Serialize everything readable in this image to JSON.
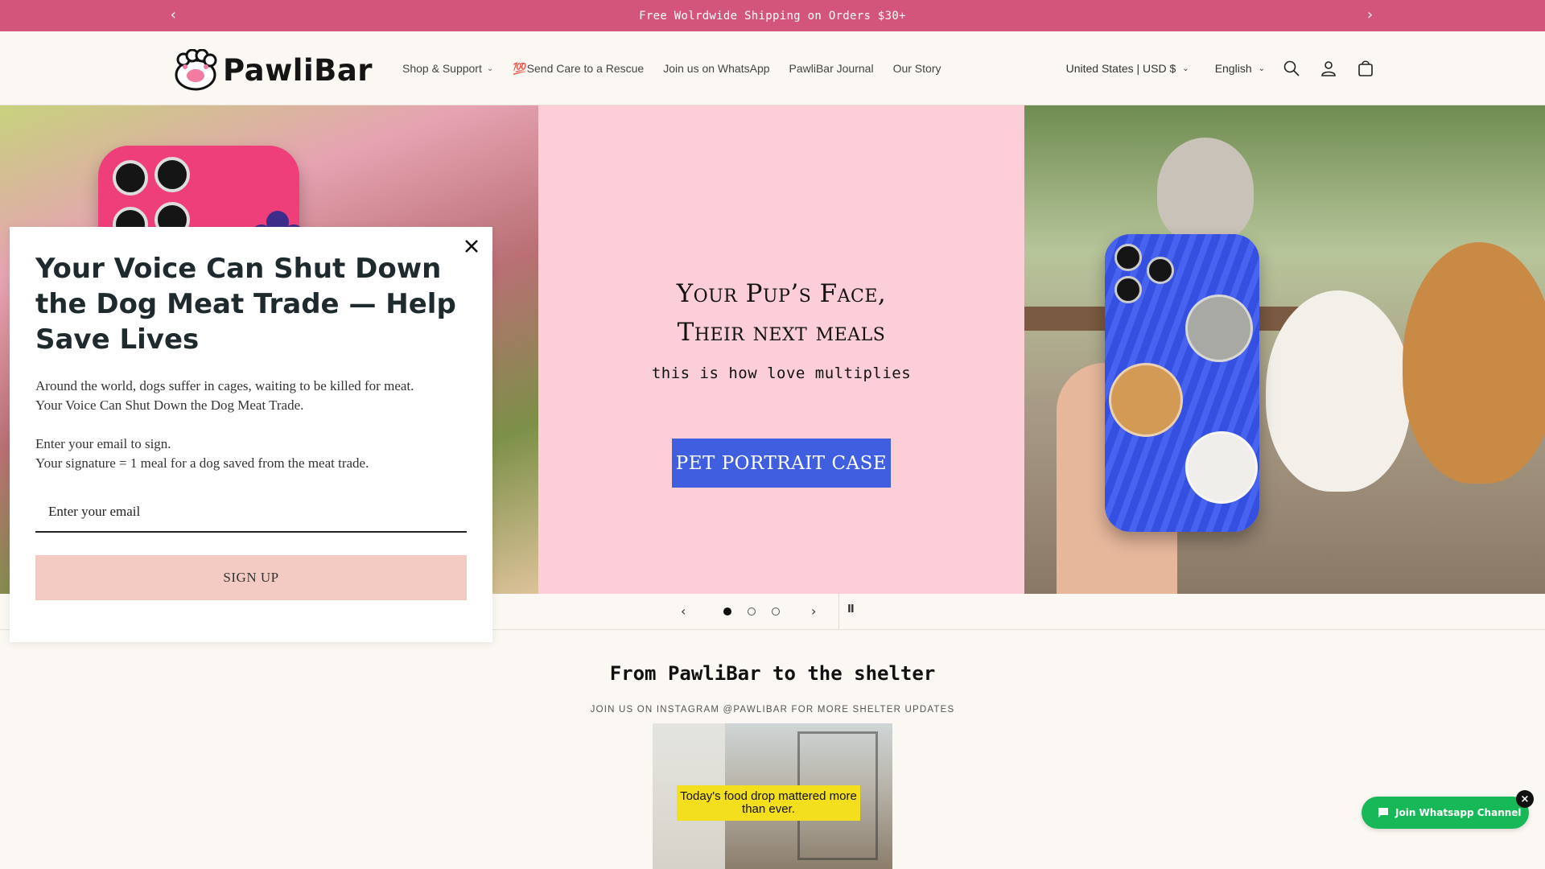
{
  "announcement": {
    "text": "Free Wolrdwide Shipping on Orders $30+",
    "prev_icon": "‹",
    "next_icon": "›"
  },
  "header": {
    "logo_text": "PawliBar",
    "nav": [
      {
        "label": "Shop & Support",
        "has_dropdown": true
      },
      {
        "label": "💯Send Care to a Rescue"
      },
      {
        "label": "Join us on WhatsApp"
      },
      {
        "label": "PawliBar Journal"
      },
      {
        "label": "Our Story"
      }
    ],
    "country_selector": "United States | USD $",
    "language_selector": "English"
  },
  "hero": {
    "title_line1": "Your Pup’s Face,",
    "title_line2": "Their next meals",
    "subtitle": "this is how love multiplies",
    "cta_label": "PET PORTRAIT CASE",
    "cta_color": "#3f5ee0",
    "panel_bg": "#fccfd8"
  },
  "slider": {
    "slide_count": 3,
    "active_slide": 1,
    "prev_icon": "‹",
    "next_icon": "›",
    "pause_icon": "II"
  },
  "section": {
    "title": "From PawliBar to the shelter",
    "subtitle": "JOIN US ON INSTAGRAM @PAWLIBAR FOR MORE SHELTER UPDATES",
    "video_caption": "Today's food drop mattered more than ever."
  },
  "popup": {
    "title": "Your Voice Can Shut Down the Dog Meat Trade — Help Save Lives",
    "body_p1_line1": "Around the world, dogs suffer in cages, waiting to be killed for meat.",
    "body_p1_line2": "Your Voice Can Shut Down the Dog Meat Trade.",
    "body_p2_line1": "Enter your email to sign.",
    "body_p2_line2": "Your signature = 1 meal for a dog saved from the meat trade.",
    "email_placeholder": "Enter your email",
    "button_label": "SIGN UP",
    "close_icon": "✕"
  },
  "whatsapp_widget": {
    "label": "Join Whatsapp Channel",
    "close_icon": "×"
  },
  "colors": {
    "announcement_bg": "#d4557a",
    "page_bg": "#fbf7f2",
    "signup_button": "#f3cbc2",
    "whatsapp_green": "#17b857"
  }
}
